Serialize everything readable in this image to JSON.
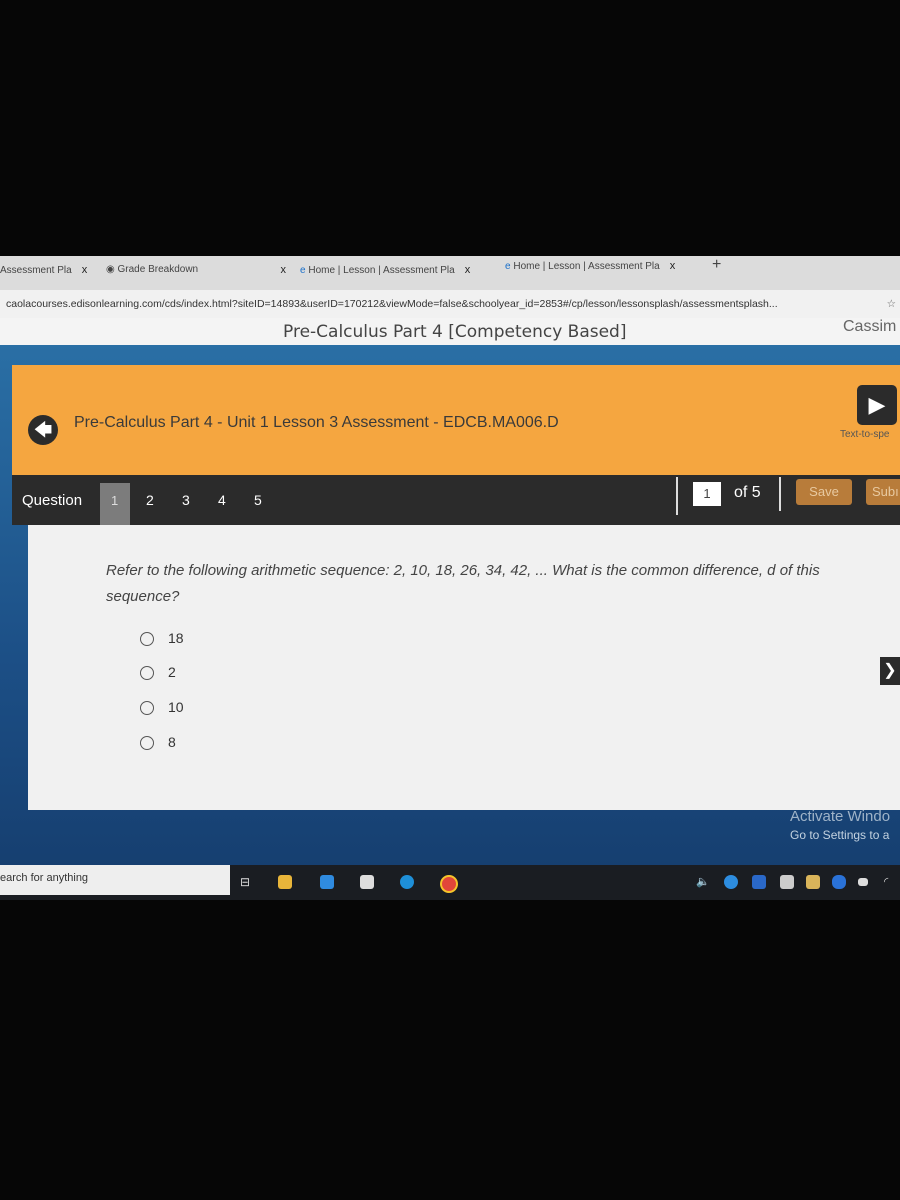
{
  "browser": {
    "tabs": [
      {
        "label": "Assessment Pla"
      },
      {
        "label": "Grade Breakdown"
      },
      {
        "label": "Home | Lesson | Assessment Pla"
      },
      {
        "label": "Home | Lesson | Assessment Pla"
      }
    ],
    "close_glyph": "x",
    "new_tab": "+",
    "url": "caolacourses.edisonlearning.com/cds/index.html?siteID=14893&userID=170212&viewMode=false&schoolyear_id=2853#/cp/lesson/lessonsplash/assessmentsplash...",
    "star_icon": "star-icon"
  },
  "page": {
    "course_title": "Pre-Calculus Part 4 [Competency Based]",
    "user_name": "Cassim"
  },
  "banner": {
    "title": "Pre-Calculus Part 4 - Unit 1 Lesson 3 Assessment - EDCB.MA006.D",
    "tts_label": "Text-to-spe",
    "color": "#f5a640"
  },
  "nav": {
    "question_label": "Question",
    "questions": [
      "1",
      "2",
      "3",
      "4",
      "5"
    ],
    "current": "1",
    "of_label": "of 5",
    "save": "Save",
    "submit": "Subı"
  },
  "question": {
    "text": "Refer to the following arithmetic sequence: 2, 10, 18, 26, 34, 42, ... What is the common difference, d of this sequence?",
    "options": [
      "18",
      "2",
      "10",
      "8"
    ]
  },
  "watermark": {
    "line1": "Activate Windo",
    "line2": "Go to Settings to a"
  },
  "taskbar": {
    "search_placeholder": "earch for anything"
  }
}
